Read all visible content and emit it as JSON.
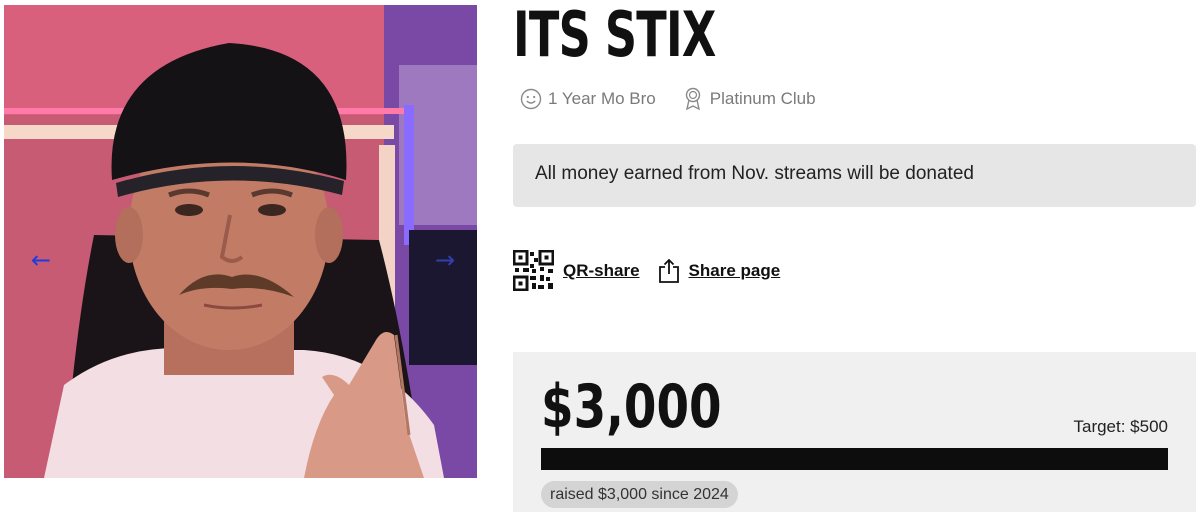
{
  "carousel": {
    "prev_icon": "arrow-left-icon",
    "next_icon": "arrow-right-icon",
    "prev_glyph": "←",
    "next_glyph": "→"
  },
  "profile": {
    "name": "ITS STIX",
    "badges": [
      {
        "icon": "smiley-icon",
        "label": "1 Year Mo Bro"
      },
      {
        "icon": "award-ribbon-icon",
        "label": "Platinum Club"
      }
    ],
    "message": "All money earned from Nov. streams will be donated"
  },
  "share": {
    "qr_label": "QR-share",
    "share_label": "Share page",
    "qr_icon": "qr-code-icon",
    "share_icon": "share-upload-icon"
  },
  "fundraising": {
    "raised_amount": "$3,000",
    "target_label": "Target: $500",
    "progress_fraction": 1.0,
    "raised_caption": "raised $3,000 since 2024",
    "bar_color": "#0d0d0d"
  }
}
